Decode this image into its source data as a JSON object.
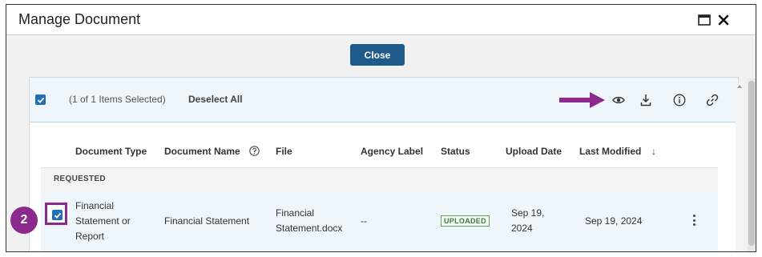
{
  "dialog": {
    "title": "Manage Document",
    "close_label": "Close"
  },
  "selection": {
    "count_text": "(1 of 1 Items Selected)",
    "deselect_label": "Deselect All"
  },
  "toolbar": {
    "icons": [
      "eye-icon",
      "download-icon",
      "info-icon",
      "link-icon"
    ],
    "annotation_color": "#8b2a8c"
  },
  "table": {
    "headers": [
      "Document Type",
      "Document Name",
      "File",
      "Agency Label",
      "Status",
      "Upload Date",
      "Last Modified"
    ],
    "sort_indicator": "↓",
    "group_label": "REQUESTED",
    "rows": [
      {
        "document_type": [
          "Financial",
          "Statement or",
          "Report"
        ],
        "document_name": "Financial Statement",
        "file": [
          "Financial",
          "Statement.docx"
        ],
        "agency_label": "--",
        "status": "UPLOADED",
        "upload_date": [
          "Sep 19,",
          "2024"
        ],
        "last_modified": "Sep 19, 2024"
      }
    ]
  },
  "annotation": {
    "step_number": "2"
  },
  "colors": {
    "primary": "#1f5a8c",
    "checkbox": "#1f6fb3",
    "selected_row": "#eef5fb",
    "status_green": "#3b7f3b"
  }
}
